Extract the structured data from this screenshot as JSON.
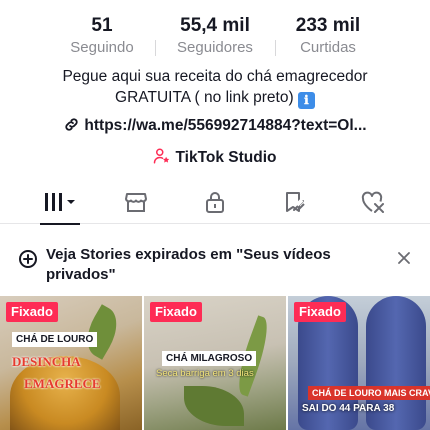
{
  "stats": {
    "following": {
      "value": "51",
      "label": "Seguindo"
    },
    "followers": {
      "value": "55,4 mil",
      "label": "Seguidores"
    },
    "likes": {
      "value": "233 mil",
      "label": "Curtidas"
    }
  },
  "bio": {
    "line1": "Pegue aqui sua receita do chá emagrecedor",
    "line2": "GRATUITA ( no link preto)",
    "emoji": "ℹ"
  },
  "link": {
    "text": "https://wa.me/556992714884?text=Ol...",
    "icon": "link-icon"
  },
  "studio": {
    "text": "TikTok Studio",
    "icon": "person-star-icon"
  },
  "tabs": [
    {
      "name": "videos-grid",
      "icon": "grid-icon",
      "active": true
    },
    {
      "name": "shop",
      "icon": "shop-icon"
    },
    {
      "name": "private",
      "icon": "lock-icon"
    },
    {
      "name": "saved",
      "icon": "bookmark-icon"
    },
    {
      "name": "liked",
      "icon": "heart-icon"
    }
  ],
  "notice": {
    "text": "Veja Stories expirados em \"Seus vídeos privados\"",
    "icon": "add-story-icon"
  },
  "videos": [
    {
      "pinned": "Fixado",
      "caption": "CHÁ DE LOURO",
      "overlay1": "DESINCHA",
      "overlay2": "EMAGRECE"
    },
    {
      "pinned": "Fixado",
      "caption": "CHÁ MILAGROSO",
      "overlay1": "Seca barriga em 3 dias"
    },
    {
      "pinned": "Fixado",
      "caption": "CHÁ DE LOURO MAIS CRAVO",
      "overlay1": "SAI DO 44 PARA 38"
    }
  ],
  "colors": {
    "accent": "#fe2c55",
    "text": "#161823",
    "muted": "#8a8b91"
  }
}
